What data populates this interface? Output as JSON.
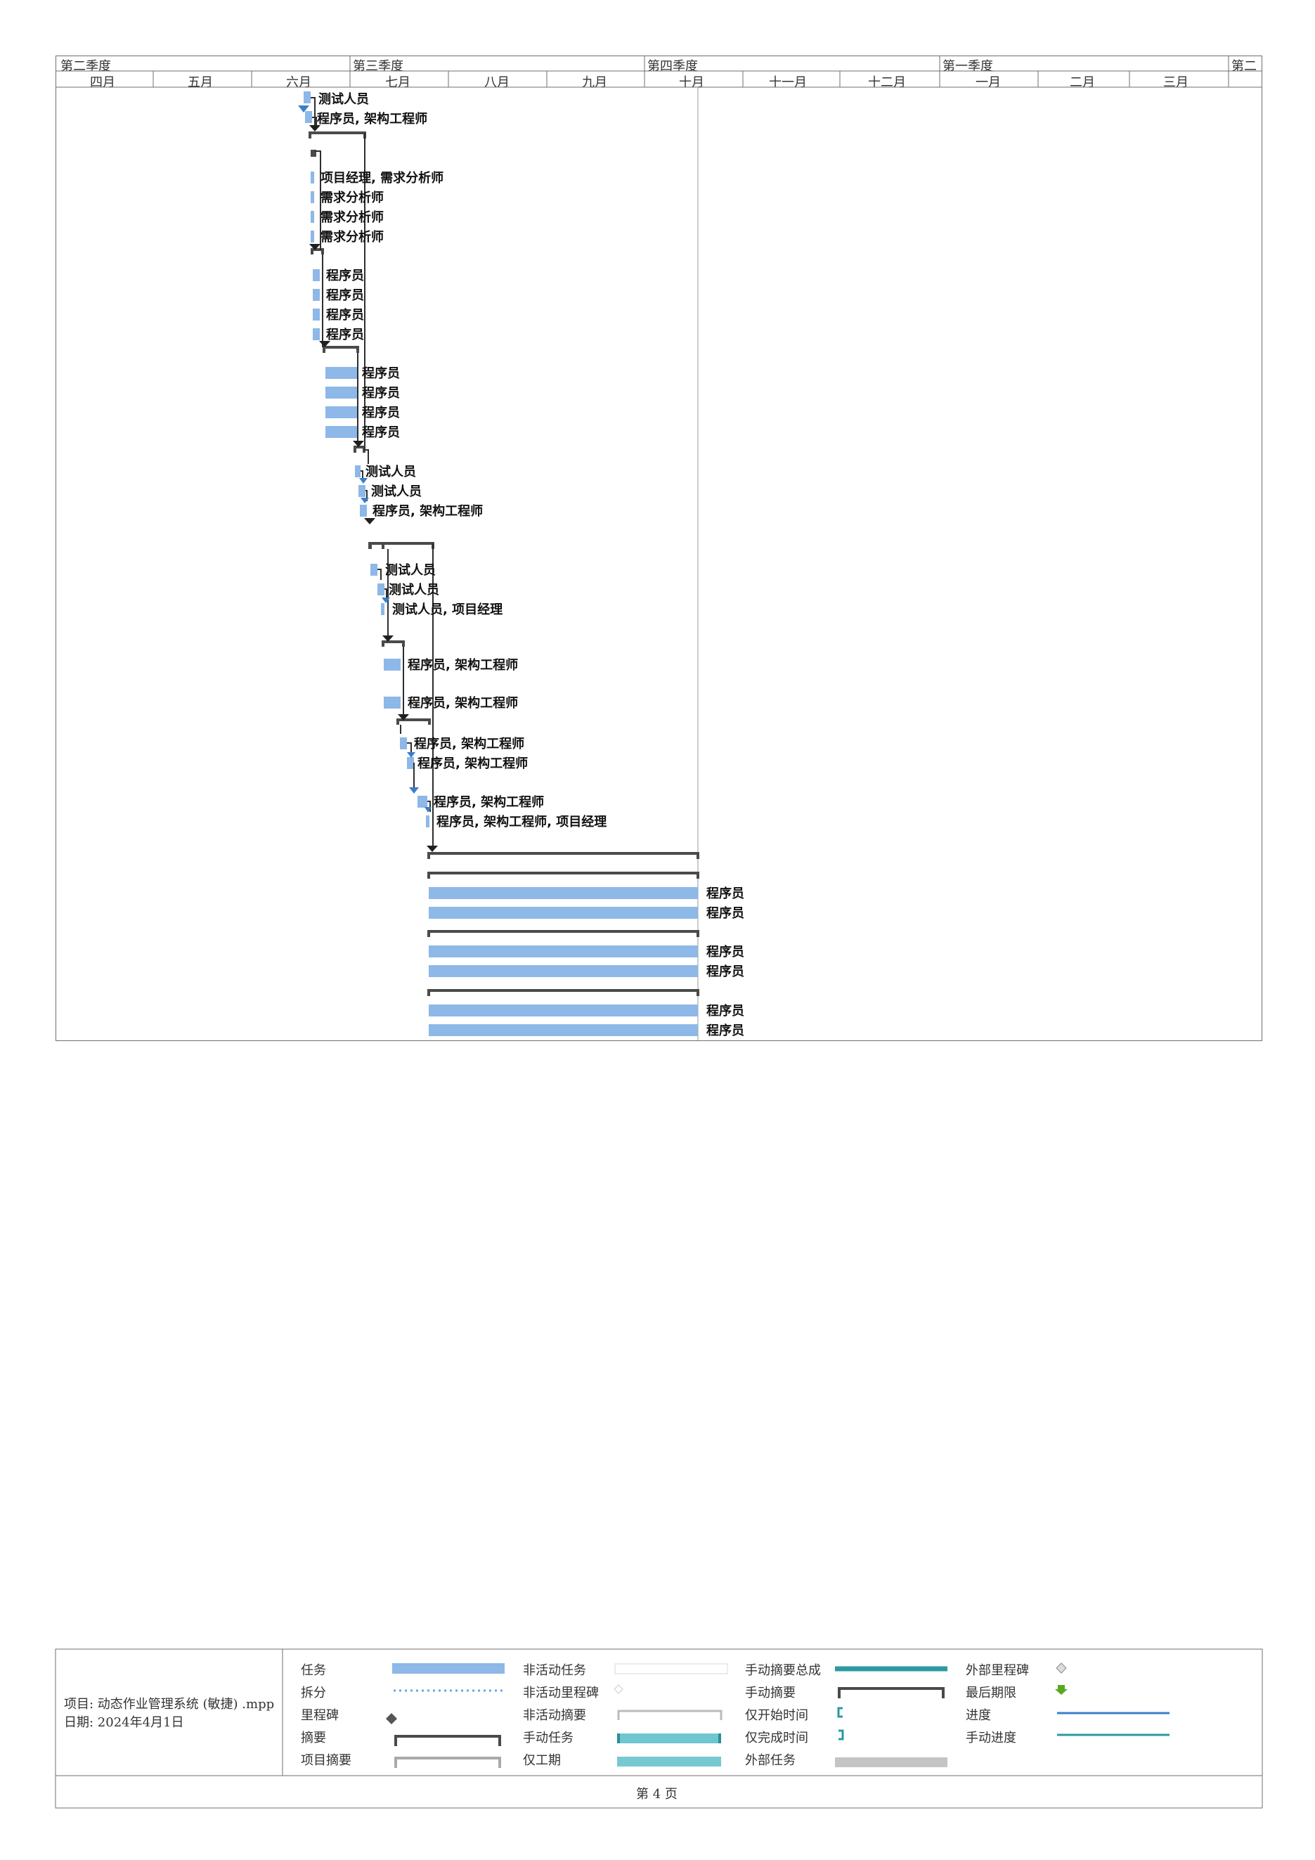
{
  "timescale": {
    "quarters": [
      "第二季度",
      "第三季度",
      "第四季度",
      "第一季度",
      "第二"
    ],
    "months": [
      "四月",
      "五月",
      "六月",
      "七月",
      "八月",
      "九月",
      "十月",
      "十一月",
      "十二月",
      "一月",
      "二月",
      "三月"
    ]
  },
  "resources": [
    "测试人员",
    "程序员, 架构工程师",
    "项目经理, 需求分析师",
    "需求分析师",
    "需求分析师",
    "需求分析师",
    "程序员",
    "程序员",
    "程序员",
    "程序员",
    "程序员",
    "程序员",
    "程序员",
    "程序员",
    "测试人员",
    "测试人员",
    "程序员, 架构工程师",
    "测试人员",
    "测试人员",
    "测试人员, 项目经理",
    "程序员, 架构工程师",
    "程序员, 架构工程师",
    "程序员, 架构工程师",
    "程序员, 架构工程师",
    "程序员, 架构工程师",
    "程序员, 架构工程师, 项目经理",
    "程序员",
    "程序员",
    "程序员",
    "程序员",
    "程序员",
    "程序员"
  ],
  "footer": {
    "project": "项目: 动态作业管理系统 (敏捷) .mpp",
    "date": "日期: 2024年4月1日"
  },
  "legend": {
    "col1": [
      "任务",
      "拆分",
      "里程碑",
      "摘要",
      "项目摘要"
    ],
    "col2": [
      "非活动任务",
      "非活动里程碑",
      "非活动摘要",
      "手动任务",
      "仅工期"
    ],
    "col3": [
      "手动摘要总成",
      "手动摘要",
      "仅开始时间",
      "仅完成时间",
      "外部任务"
    ],
    "col4": [
      "外部里程碑",
      "最后期限",
      "进度",
      "手动进度"
    ]
  },
  "page": {
    "label": "第 4 页"
  },
  "colors": {
    "task": "#8db8e8",
    "summary": "#4a4a4a",
    "milestone": "#3a7fc8",
    "manual": "#3aa6b0",
    "deadline": "#5aa820"
  }
}
